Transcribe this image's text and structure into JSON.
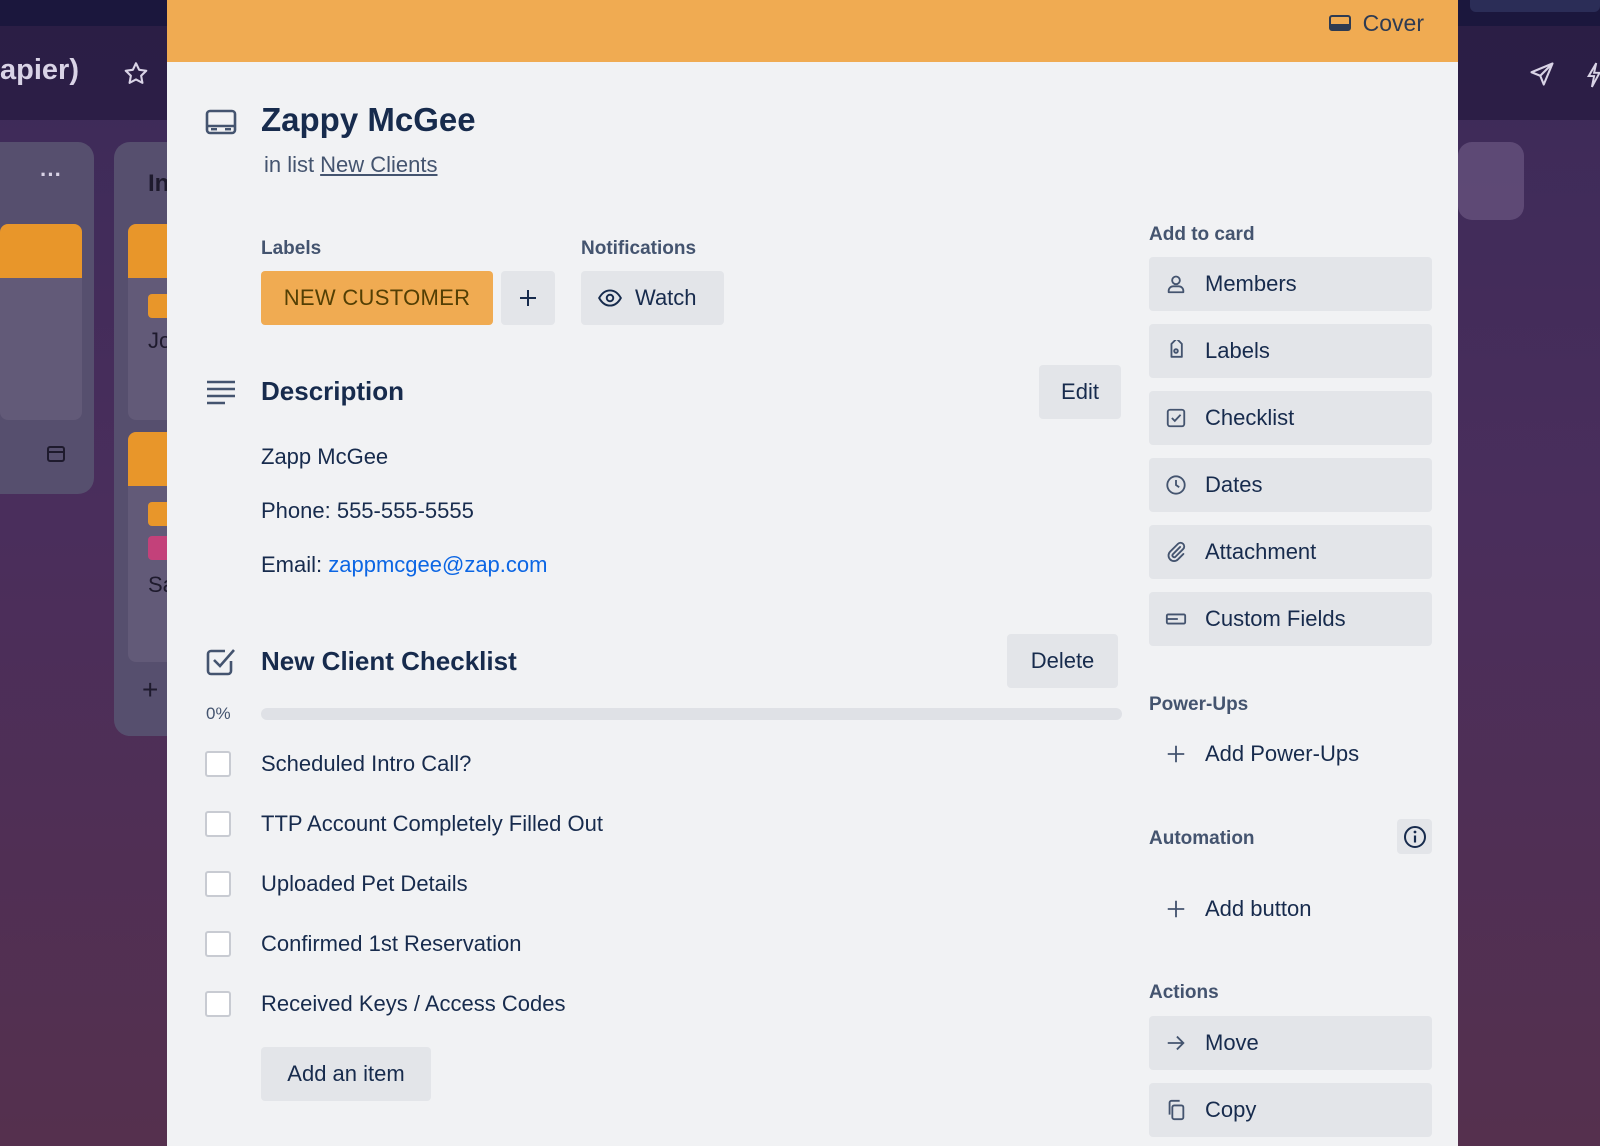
{
  "board": {
    "title_fragment": "apier)",
    "list_fragment_1": "In",
    "card_fragment_1": "Jo",
    "card_fragment_2": "Sa",
    "menu_dots": "···"
  },
  "cover": {
    "label": "Cover",
    "color": "#f0ab52"
  },
  "card": {
    "title": "Zappy McGee",
    "in_list_prefix": "in list",
    "list_name": "New Clients"
  },
  "labels_section": {
    "heading": "Labels",
    "chip_text": "NEW CUSTOMER",
    "chip_color": "#f0ab52",
    "add_glyph": "+"
  },
  "notifications": {
    "heading": "Notifications",
    "watch_label": "Watch"
  },
  "description": {
    "heading": "Description",
    "edit_label": "Edit",
    "line1": "Zapp McGee",
    "phone_line": "Phone: 555-555-5555",
    "email_prefix": "Email:",
    "email": "zappmcgee@zap.com"
  },
  "checklist": {
    "heading": "New Client Checklist",
    "delete_label": "Delete",
    "progress_text": "0%",
    "progress_value": 0,
    "items": [
      {
        "text": "Scheduled Intro Call?",
        "checked": false
      },
      {
        "text": "TTP Account Completely Filled Out",
        "checked": false
      },
      {
        "text": "Uploaded Pet Details",
        "checked": false
      },
      {
        "text": "Confirmed 1st Reservation",
        "checked": false
      },
      {
        "text": "Received Keys / Access Codes",
        "checked": false
      }
    ],
    "add_item_label": "Add an item"
  },
  "sidebar": {
    "add_to_card_heading": "Add to card",
    "add_to_card": [
      {
        "label": "Members",
        "icon": "person-icon"
      },
      {
        "label": "Labels",
        "icon": "tag-icon"
      },
      {
        "label": "Checklist",
        "icon": "checkbox-icon"
      },
      {
        "label": "Dates",
        "icon": "clock-icon"
      },
      {
        "label": "Attachment",
        "icon": "paperclip-icon"
      },
      {
        "label": "Custom Fields",
        "icon": "fields-icon"
      }
    ],
    "powerups_heading": "Power-Ups",
    "add_powerups_label": "Add Power-Ups",
    "automation_heading": "Automation",
    "add_button_label": "Add button",
    "actions_heading": "Actions",
    "actions": [
      {
        "label": "Move",
        "icon": "arrow-right-icon"
      },
      {
        "label": "Copy",
        "icon": "copy-icon"
      }
    ]
  }
}
